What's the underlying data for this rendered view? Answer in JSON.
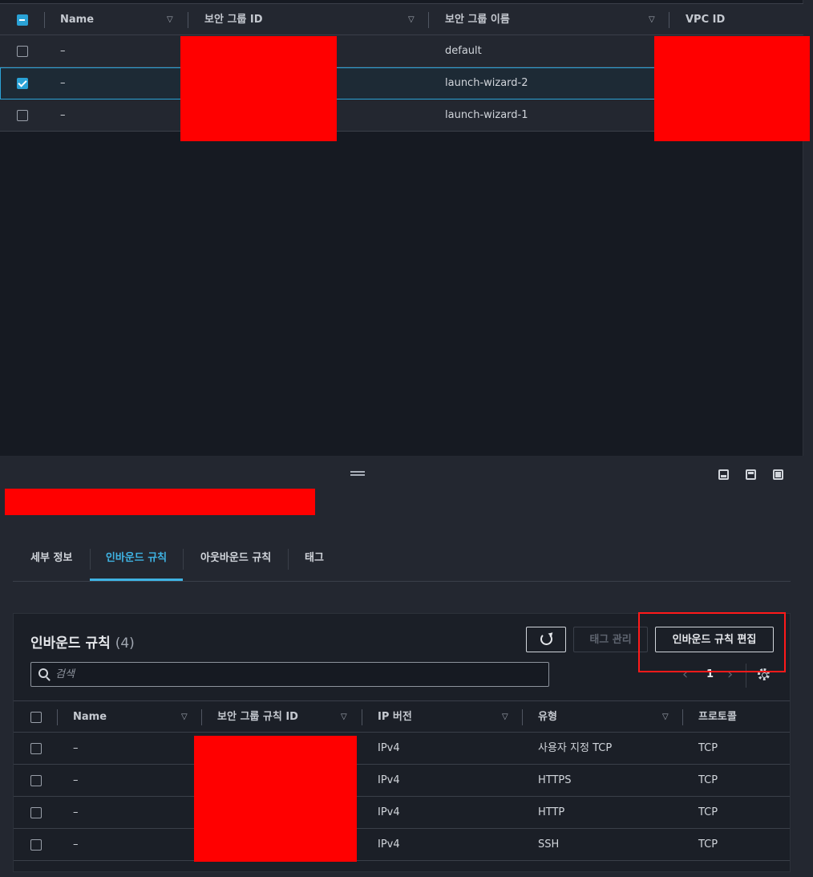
{
  "security_groups": {
    "columns": [
      "Name",
      "보안 그룹 ID",
      "보안 그룹 이름",
      "VPC ID"
    ],
    "rows": [
      {
        "name": "–",
        "group_name": "default",
        "selected": false
      },
      {
        "name": "–",
        "group_name": "launch-wizard-2",
        "selected": true
      },
      {
        "name": "–",
        "group_name": "launch-wizard-1",
        "selected": false
      }
    ]
  },
  "tabs": [
    {
      "label": "세부 정보",
      "active": false
    },
    {
      "label": "인바운드 규칙",
      "active": true
    },
    {
      "label": "아웃바운드 규칙",
      "active": false
    },
    {
      "label": "태그",
      "active": false
    }
  ],
  "inbound": {
    "title": "인바운드 규칙",
    "count": "(4)",
    "manage_tags_label": "태그 관리",
    "edit_rules_label": "인바운드 규칙 편집",
    "search_placeholder": "검색",
    "page": "1",
    "columns": [
      "Name",
      "보안 그룹 규칙 ID",
      "IP 버전",
      "유형",
      "프로토콜"
    ],
    "rows": [
      {
        "name": "–",
        "ip_version": "IPv4",
        "type": "사용자 지정 TCP",
        "protocol": "TCP"
      },
      {
        "name": "–",
        "ip_version": "IPv4",
        "type": "HTTPS",
        "protocol": "TCP"
      },
      {
        "name": "–",
        "ip_version": "IPv4",
        "type": "HTTP",
        "protocol": "TCP"
      },
      {
        "name": "–",
        "ip_version": "IPv4",
        "type": "SSH",
        "protocol": "TCP"
      }
    ]
  },
  "colors": {
    "accent": "#2aa2d6",
    "redaction": "#ff0000",
    "highlight": "#ff1a1a"
  }
}
